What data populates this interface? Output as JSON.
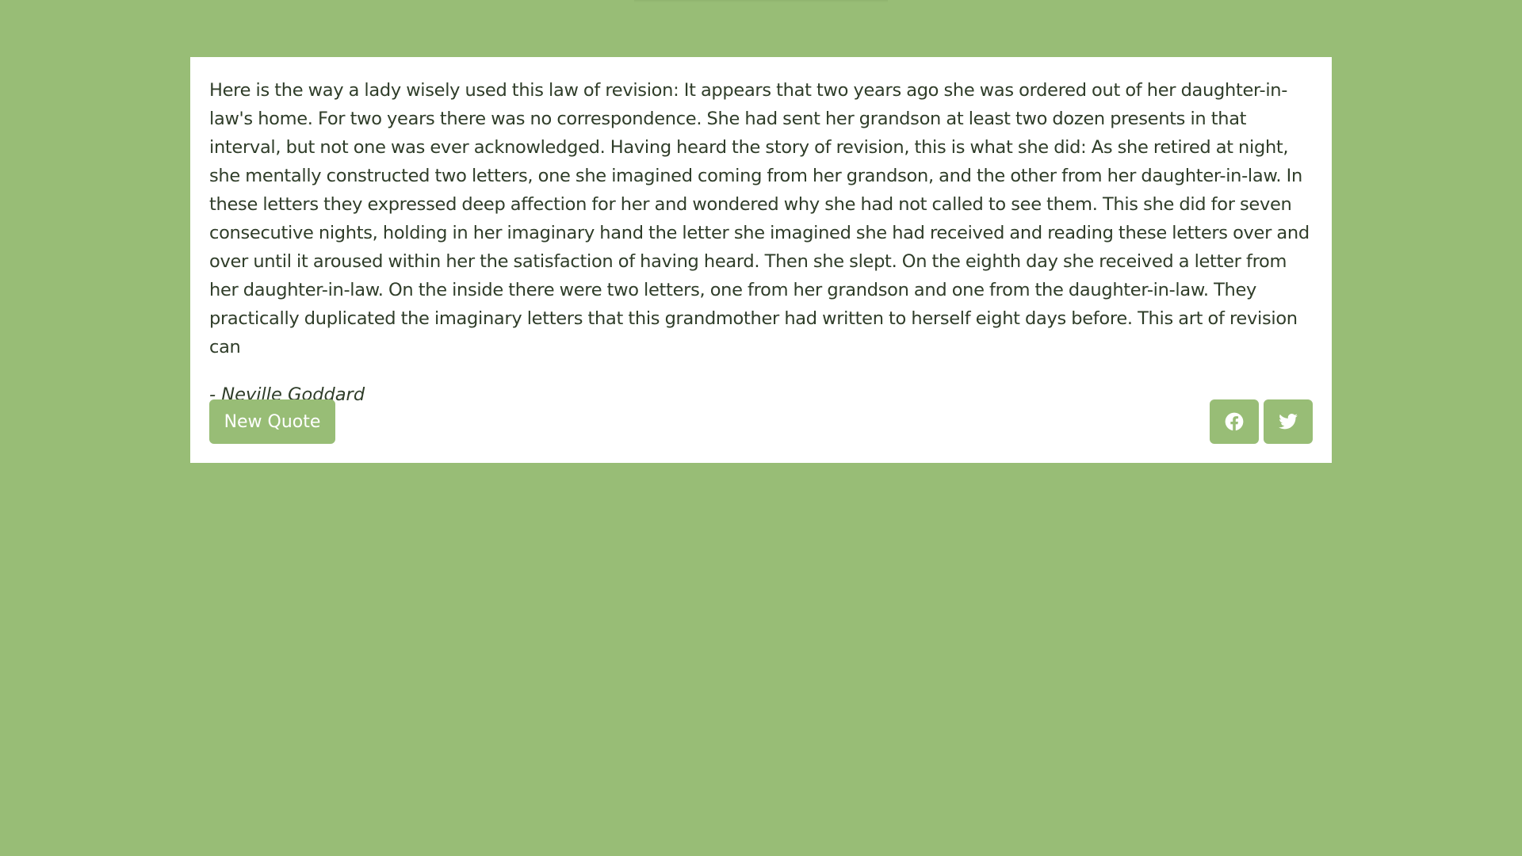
{
  "quote": {
    "text": "Here is the way a lady wisely used this law of revision: It appears that two years ago she was ordered out of her daughter-in-law's home. For two years there was no correspondence. She had sent her grandson at least two dozen presents in that interval, but not one was ever acknowledged. Having heard the story of revision, this is what she did: As she retired at night, she mentally constructed two letters, one she imagined coming from her grandson, and the other from her daughter-in-law. In these letters they expressed deep affection for her and wondered why she had not called to see them. This she did for seven consecutive nights, holding in her imaginary hand the letter she imagined she had received and reading these letters over and over until it aroused within her the satisfaction of having heard. Then she slept. On the eighth day she received a letter from her daughter-in-law. On the inside there were two letters, one from her grandson and one from the daughter-in-law. They practically duplicated the imaginary letters that this grandmother had written to herself eight days before. This art of revision can",
    "author": "- Neville Goddard"
  },
  "actions": {
    "new_quote_label": "New Quote",
    "share_icons": [
      "facebook-icon",
      "twitter-icon"
    ]
  },
  "colors": {
    "background": "#98bd76",
    "card": "#ffffff",
    "text": "#2f3d29",
    "button": "#98bd76",
    "button_text": "#ffffff"
  }
}
